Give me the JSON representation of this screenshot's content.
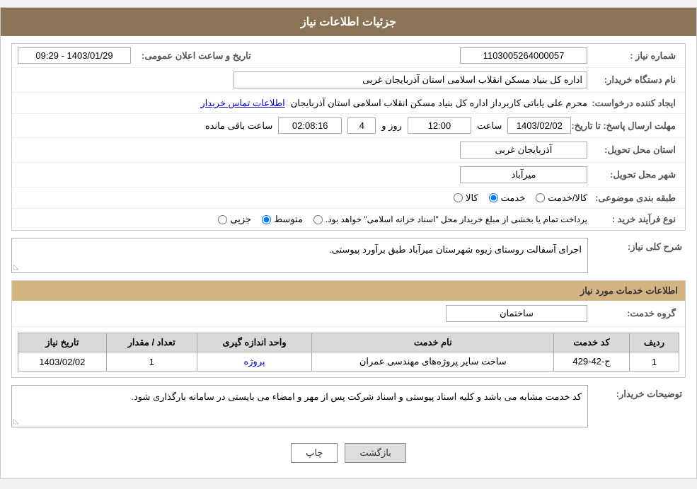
{
  "page": {
    "title": "جزئیات اطلاعات نیاز"
  },
  "header": {
    "need_number_label": "شماره نیاز :",
    "need_number_value": "1103005264000057",
    "announce_label": "تاریخ و ساعت اعلان عمومی:",
    "announce_value": "1403/01/29 - 09:29",
    "buyer_label": "نام دستگاه خریدار:",
    "buyer_value": "اداره کل بنیاد مسکن انقلاب اسلامی استان آذربایجان غربی",
    "creator_label": "ایجاد کننده درخواست:",
    "creator_value": "محرم علی یاباتی کاربرداز اداره کل بنیاد مسکن انقلاب اسلامی استان آذربایجان",
    "contact_link": "اطلاعات تماس خریدار",
    "deadline_label": "مهلت ارسال پاسخ: تا تاریخ:",
    "deadline_date": "1403/02/02",
    "deadline_time_label": "ساعت",
    "deadline_time": "12:00",
    "deadline_days_label": "روز و",
    "deadline_days": "4",
    "deadline_remaining_label": "ساعت باقی مانده",
    "deadline_remaining": "02:08:16",
    "province_label": "استان محل تحویل:",
    "province_value": "آذربایجان غربی",
    "city_label": "شهر محل تحویل:",
    "city_value": "میرآباد",
    "category_label": "طبقه بندی موضوعی:",
    "category_options": [
      "کالا",
      "خدمت",
      "کالا/خدمت"
    ],
    "category_selected": "خدمت",
    "purchase_label": "نوع فرآیند خرید :",
    "purchase_options": [
      "جزیی",
      "متوسط",
      "پرداخت تمام یا بخشی از مبلغ خریداز محل \"اسناد خزانه اسلامی\" خواهد بود."
    ],
    "purchase_selected": "متوسط"
  },
  "description": {
    "section_title": "شرح کلی نیاز:",
    "content": "اجرای آسفالت روستای زیوه شهرستان میرآباد طبق برآورد پیوستی."
  },
  "services_section": {
    "title": "اطلاعات خدمات مورد نیاز",
    "group_label": "گروه خدمت:",
    "group_value": "ساختمان",
    "table": {
      "columns": [
        "ردیف",
        "کد خدمت",
        "نام خدمت",
        "واحد اندازه گیری",
        "تعداد / مقدار",
        "تاریخ نیاز"
      ],
      "rows": [
        {
          "row_num": "1",
          "code": "ج-42-429",
          "name": "ساخت سایر پروژه‌های مهندسی عمران",
          "unit": "پروژه",
          "quantity": "1",
          "date": "1403/02/02"
        }
      ]
    }
  },
  "buyer_notes": {
    "label": "توضیحات خریدار:",
    "content": "کد خدمت مشابه می باشد و کلیه اسناد پیوستی و اسناد شرکت پس از مهر و امضاء می بایستی در سامانه بارگذاری شود."
  },
  "buttons": {
    "print": "چاپ",
    "back": "بازگشت"
  }
}
